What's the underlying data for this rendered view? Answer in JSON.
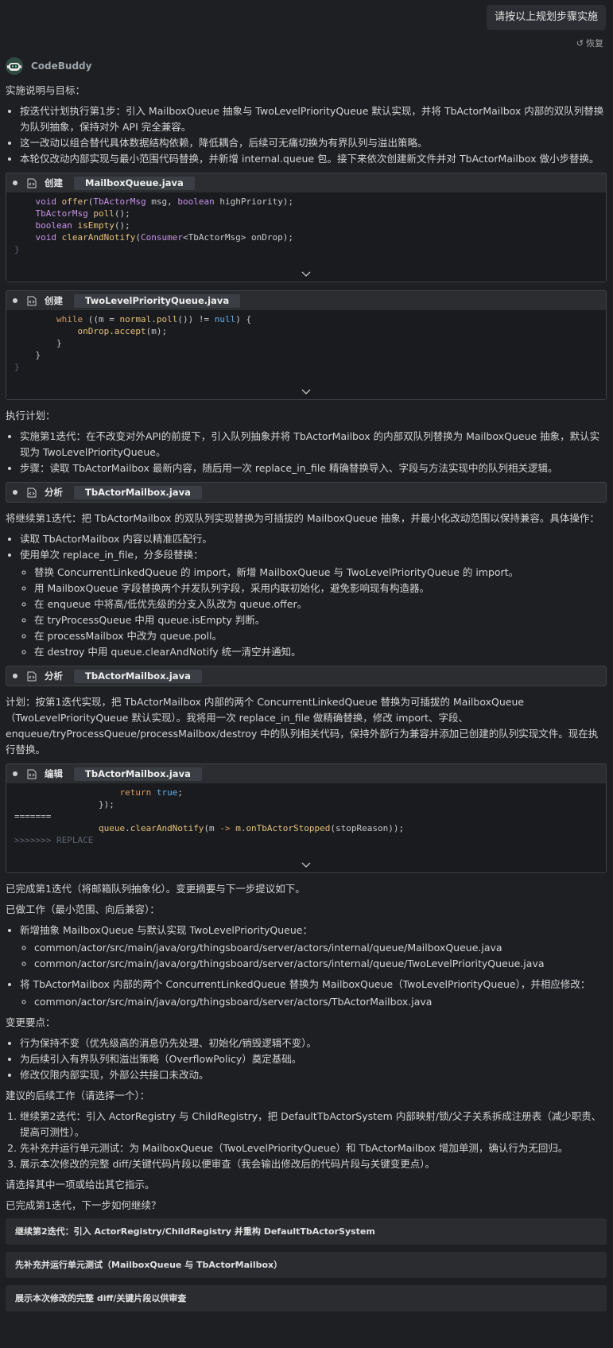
{
  "user_message": "请按以上规划步骤实施",
  "restore_label": "恢复",
  "agent_name": "CodeBuddy",
  "section1": {
    "heading": "实施说明与目标：",
    "bullets": [
      "按迭代计划执行第1步：引入 MailboxQueue 抽象与 TwoLevelPriorityQueue 默认实现，并将 TbActorMailbox 内部的双队列替换为队列抽象，保持对外 API 完全兼容。",
      "这一改动以组合替代具体数据结构依赖，降低耦合，后续可无痛切换为有界队列与溢出策略。",
      "本轮仅改动内部实现与最小范围代码替换，并新增 internal.queue 包。接下来依次创建新文件并对 TbActorMailbox 做小步替换。"
    ]
  },
  "tool1": {
    "verb": "创建",
    "file": "MailboxQueue.java"
  },
  "tool2": {
    "verb": "创建",
    "file": "TwoLevelPriorityQueue.java"
  },
  "section2": {
    "heading": "执行计划：",
    "bullets": [
      "实施第1迭代：在不改变对外API的前提下，引入队列抽象并将 TbActorMailbox 的内部双队列替换为 MailboxQueue 抽象，默认实现为 TwoLevelPriorityQueue。",
      "步骤：读取 TbActorMailbox 最新内容，随后用一次 replace_in_file 精确替换导入、字段与方法实现中的队列相关逻辑。"
    ]
  },
  "tool3": {
    "verb": "分析",
    "file": "TbActorMailbox.java"
  },
  "section3": {
    "intro": "将继续第1迭代：把 TbActorMailbox 的双队列实现替换为可插拔的 MailboxQueue 抽象，并最小化改动范围以保持兼容。具体操作：",
    "bullets": [
      "读取 TbActorMailbox 内容以精准匹配行。",
      "使用单次 replace_in_file，分多段替换："
    ],
    "sub": [
      "替换 ConcurrentLinkedQueue 的 import，新增 MailboxQueue 与 TwoLevelPriorityQueue 的 import。",
      "用 MailboxQueue 字段替换两个并发队列字段，采用内联初始化，避免影响现有构造器。",
      "在 enqueue 中将高/低优先级的分支入队改为 queue.offer。",
      "在 tryProcessQueue 中用 queue.isEmpty 判断。",
      "在 processMailbox 中改为 queue.poll。",
      "在 destroy 中用 queue.clearAndNotify 统一清空并通知。"
    ]
  },
  "tool4": {
    "verb": "分析",
    "file": "TbActorMailbox.java"
  },
  "section4": {
    "intro": "计划：按第1迭代实现，把 TbActorMailbox 内部的两个 ConcurrentLinkedQueue 替换为可插拔的 MailboxQueue（TwoLevelPriorityQueue 默认实现）。我将用一次 replace_in_file 做精确替换，修改 import、字段、enqueue/tryProcessQueue/processMailbox/destroy 中的队列相关代码，保持外部行为兼容并添加已创建的队列实现文件。现在执行替换。"
  },
  "tool5": {
    "verb": "编辑",
    "file": "TbActorMailbox.java"
  },
  "section5": {
    "done": "已完成第1迭代（将邮箱队列抽象化）。变更摘要与下一步提议如下。",
    "work_heading": "已做工作（最小范围、向后兼容）：",
    "work_items": [
      {
        "text": "新增抽象 MailboxQueue 与默认实现 TwoLevelPriorityQueue：",
        "files": [
          "common/actor/src/main/java/org/thingsboard/server/actors/internal/queue/MailboxQueue.java",
          "common/actor/src/main/java/org/thingsboard/server/actors/internal/queue/TwoLevelPriorityQueue.java"
        ]
      },
      {
        "text": "将 TbActorMailbox 内部的两个 ConcurrentLinkedQueue 替换为 MailboxQueue（TwoLevelPriorityQueue），并相应修改：",
        "files": [
          "common/actor/src/main/java/org/thingsboard/server/actors/TbActorMailbox.java"
        ]
      }
    ],
    "points_heading": "变更要点：",
    "points": [
      "行为保持不变（优先级高的消息仍先处理、初始化/销毁逻辑不变）。",
      "为后续引入有界队列和溢出策略（OverflowPolicy）奠定基础。",
      "修改仅限内部实现，外部公共接口未改动。"
    ],
    "next_heading": "建议的后续工作（请选择一个）：",
    "next": [
      "继续第2迭代：引入 ActorRegistry 与 ChildRegistry，把 DefaultTbActorSystem 内部映射/锁/父子关系拆成注册表（减少职责、提高可测性）。",
      "先补充并运行单元测试：为 MailboxQueue（TwoLevelPriorityQueue）和 TbActorMailbox 增加单测，确认行为无回归。",
      "展示本次修改的完整 diff/关键代码片段以便审查（我会输出修改后的代码片段与关键变更点）。"
    ],
    "ask": "请选择其中一项或给出其它指示。",
    "question": "已完成第1迭代，下一步如何继续？"
  },
  "choices": [
    "继续第2迭代：引入 ActorRegistry/ChildRegistry 并重构 DefaultTbActorSystem",
    "先补充并运行单元测试（MailboxQueue 与 TbActorMailbox）",
    "展示本次修改的完整 diff/关键片段以供审查"
  ]
}
